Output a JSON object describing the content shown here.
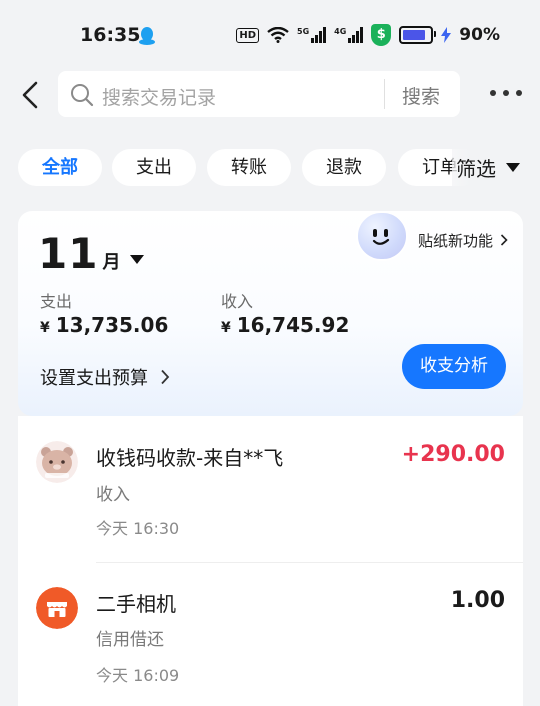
{
  "status_bar": {
    "time": "16:35",
    "hd": "HD",
    "signal1": "5G",
    "signal2": "4G",
    "battery_pct": "90%",
    "battery_level": 0.9
  },
  "header": {
    "search_placeholder": "搜索交易记录",
    "search_button": "搜索"
  },
  "filters": {
    "chips": [
      "全部",
      "支出",
      "转账",
      "退款",
      "订单"
    ],
    "active": "全部",
    "filter_label": "筛选"
  },
  "summary": {
    "month_num": "11",
    "month_unit": "月",
    "sticker_promo": "贴纸新功能",
    "expense_label": "支出",
    "expense_currency": "¥",
    "expense_amount": "13,735.06",
    "income_label": "收入",
    "income_currency": "¥",
    "income_amount": "16,745.92",
    "budget_label": "设置支出预算",
    "analysis_button": "收支分析"
  },
  "transactions": [
    {
      "title": "收钱码收款-来自**飞",
      "category": "收入",
      "time": "今天 16:30",
      "amount": "+290.00",
      "amount_color": "#e8344e",
      "icon": "bear-avatar-icon"
    },
    {
      "title": "二手相机",
      "category": "信用借还",
      "time": "今天 16:09",
      "amount": "1.00",
      "amount_color": "#1a1a1a",
      "icon": "shop-icon"
    }
  ],
  "colors": {
    "accent": "#1677ff",
    "income_red": "#e8344e",
    "shop_orange": "#f05a28"
  }
}
